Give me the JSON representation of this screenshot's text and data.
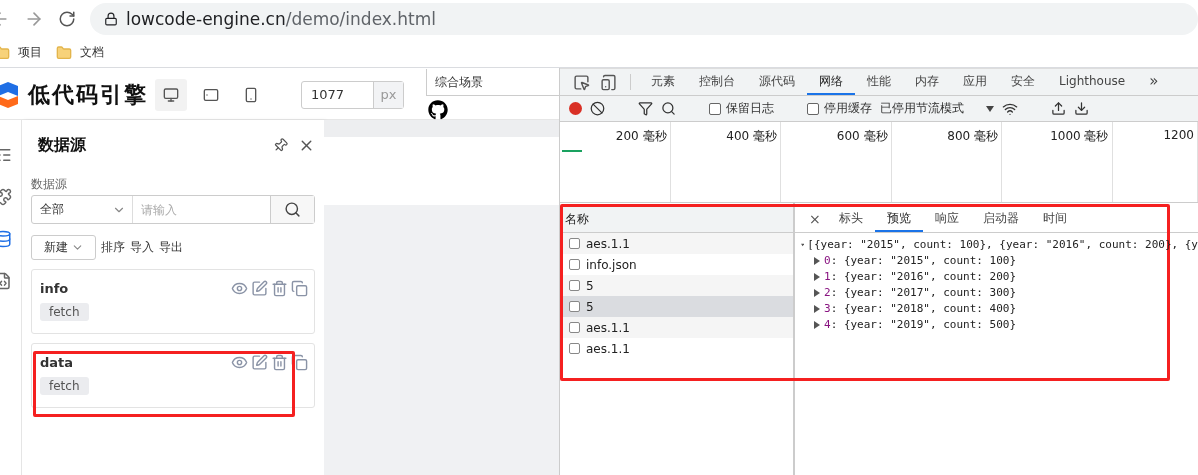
{
  "browser": {
    "url_host": "lowcode-engine.cn",
    "url_path": "/demo/index.html",
    "bookmarks": [
      "项目",
      "文档"
    ]
  },
  "app": {
    "logo_text": "低代码引擎",
    "devices": [
      {
        "kind": "desktop",
        "selected": true
      },
      {
        "kind": "tablet",
        "selected": false
      },
      {
        "kind": "phone",
        "selected": false
      }
    ],
    "width_value": "1077",
    "width_unit": "px",
    "scene": "综合场景"
  },
  "panel": {
    "title": "数据源",
    "filter_label": "数据源",
    "type_select": "全部",
    "search_placeholder": "请输入",
    "new_button": "新建",
    "actions": [
      "排序",
      "导入",
      "导出"
    ],
    "sources": [
      {
        "name": "info",
        "type": "fetch",
        "highlighted": false
      },
      {
        "name": "data",
        "type": "fetch",
        "highlighted": true
      }
    ]
  },
  "devtools": {
    "tabs": [
      {
        "label": "元素",
        "selected": false
      },
      {
        "label": "控制台",
        "selected": false
      },
      {
        "label": "源代码",
        "selected": false
      },
      {
        "label": "网络",
        "selected": true
      },
      {
        "label": "性能",
        "selected": false
      },
      {
        "label": "内存",
        "selected": false
      },
      {
        "label": "应用",
        "selected": false
      },
      {
        "label": "安全",
        "selected": false
      },
      {
        "label": "Lighthouse",
        "selected": false
      }
    ],
    "more": "»",
    "preserve_log": {
      "label": "保留日志",
      "checked": false
    },
    "disable_cache": {
      "label": "停用缓存",
      "checked": false
    },
    "throttle": "已停用节流模式",
    "timeline_ticks": [
      "200 毫秒",
      "400 毫秒",
      "600 毫秒",
      "800 毫秒",
      "1000 毫秒",
      "1200"
    ],
    "name_header": "名称",
    "highlighted": true,
    "requests": [
      {
        "name": "aes.1.1",
        "selected": false
      },
      {
        "name": "info.json",
        "selected": false
      },
      {
        "name": "5",
        "selected": false
      },
      {
        "name": "5",
        "selected": true
      },
      {
        "name": "aes.1.1",
        "selected": false
      },
      {
        "name": "aes.1.1",
        "selected": false
      }
    ],
    "close": "×",
    "detail_tabs": [
      {
        "label": "标头",
        "selected": false
      },
      {
        "label": "预览",
        "selected": true
      },
      {
        "label": "响应",
        "selected": false
      },
      {
        "label": "启动器",
        "selected": false
      },
      {
        "label": "时间",
        "selected": false
      }
    ],
    "preview_summary": "[{year: \"2015\", count: 100}, {year: \"2016\", count: 200}, {y",
    "preview_items": [
      {
        "index": "0",
        "separator": ":",
        "value": "{year: \"2015\", count: 100}"
      },
      {
        "index": "1",
        "separator": ":",
        "value": "{year: \"2016\", count: 200}"
      },
      {
        "index": "2",
        "separator": ":",
        "value": "{year: \"2017\", count: 300}"
      },
      {
        "index": "3",
        "separator": ":",
        "value": "{year: \"2018\", count: 400}"
      },
      {
        "index": "4",
        "separator": ":",
        "value": "{year: \"2019\", count: 500}"
      }
    ]
  }
}
